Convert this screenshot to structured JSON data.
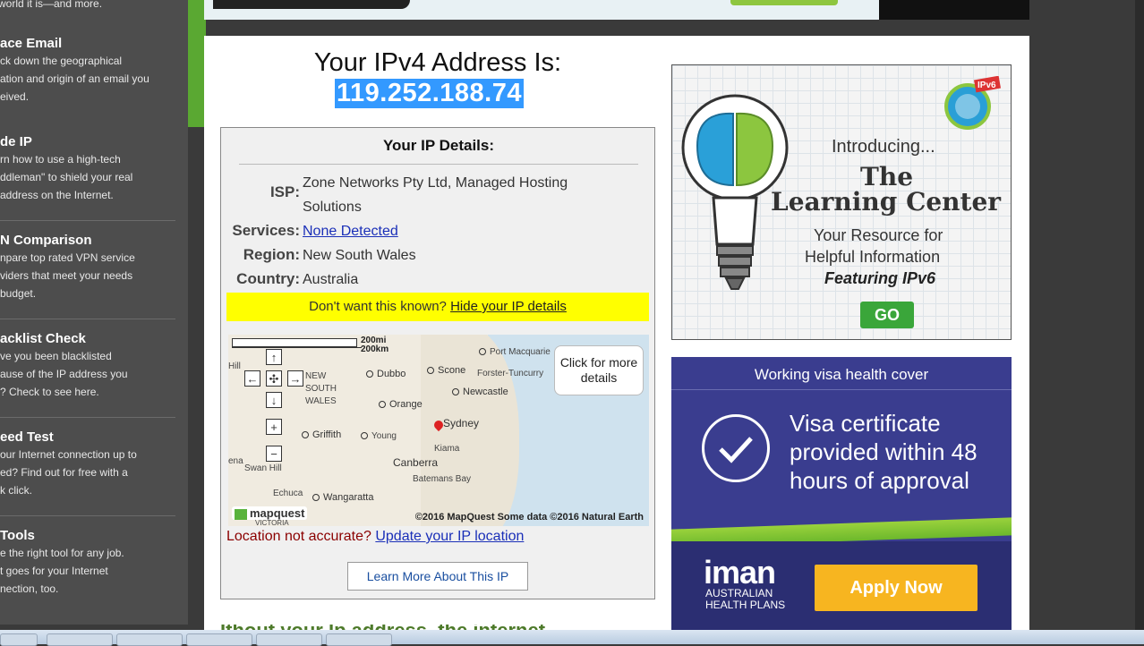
{
  "sidebar": {
    "items": [
      {
        "title": "",
        "desc": [
          "world it is—and more."
        ]
      },
      {
        "title": "ace Email",
        "desc": [
          "ck down the geographical",
          "ation and origin of an email you",
          "eived."
        ]
      },
      {
        "title": "de IP",
        "desc": [
          "rn how to use a high-tech",
          "ddleman\" to shield your real",
          "address on the Internet."
        ]
      },
      {
        "title": "N Comparison",
        "desc": [
          "npare top rated VPN service",
          "viders that meet your needs",
          "budget."
        ]
      },
      {
        "title": "acklist Check",
        "desc": [
          "ve you been blacklisted",
          "ause of the IP address you",
          "? Check to see here."
        ]
      },
      {
        "title": "eed Test",
        "desc": [
          "our Internet connection up to",
          "ed? Find out for free with a",
          "k click."
        ]
      },
      {
        "title": "Tools",
        "desc": [
          "e the right tool for any job.",
          "t goes for your Internet",
          "nection, too."
        ]
      }
    ]
  },
  "main": {
    "title": "Your IPv4 Address Is:",
    "ip": "119.252.188.74",
    "details": {
      "heading": "Your IP Details:",
      "isp_label": "ISP:",
      "isp_value": "Zone Networks Pty Ltd, Managed Hosting Solutions",
      "services_label": "Services:",
      "services_value": "None Detected",
      "region_label": "Region:",
      "region_value": "New South Wales",
      "country_label": "Country:",
      "country_value": "Australia",
      "hide_prompt": "Don't want this known?",
      "hide_link": "Hide your IP details",
      "location_prompt": "Location not accurate?",
      "location_link": "Update your IP location",
      "learn_more": "Learn More About This IP"
    },
    "map": {
      "scale_mi": "200mi",
      "scale_km": "200km",
      "callout": "Click for more details",
      "brand": "mapquest",
      "copyright": "©2016 MapQuest Some data ©2016 Natural Earth",
      "region": "NEW SOUTH WALES",
      "places": [
        "Hill",
        "Dubbo",
        "Scone",
        "Port Macquarie",
        "Forster-Tuncurry",
        "Newcastle",
        "Orange",
        "Sydney",
        "Griffith",
        "Young",
        "Kiama",
        "Canberra",
        "Swan Hill",
        "Batemans Bay",
        "Echuca",
        "Wangaratta",
        "VICTORIA",
        "ena"
      ]
    },
    "bottom_heading": "Ithout your Ip address, the internet would..."
  },
  "ads": {
    "learning": {
      "intro": "Introducing...",
      "title1": "The",
      "title2": "Learning Center",
      "line1": "Your Resource for",
      "line2": "Helpful Information",
      "featuring": "Featuring IPv6",
      "go": "GO",
      "badge": "IPv6"
    },
    "visa": {
      "header": "Working visa health cover",
      "body": "Visa certificate provided within 48 hours of approval",
      "brand": "iman",
      "brand_sub1": "AUSTRALIAN",
      "brand_sub2": "HEALTH PLANS",
      "apply": "Apply Now"
    }
  },
  "colors": {
    "sidebar_bg": "#4d4d4d",
    "green": "#5aa832",
    "ip_highlight": "#3399ff",
    "yellow": "#ffff00",
    "link": "#1a2fb8",
    "visa_bg": "#3a3d8f",
    "apply": "#f7b520"
  }
}
